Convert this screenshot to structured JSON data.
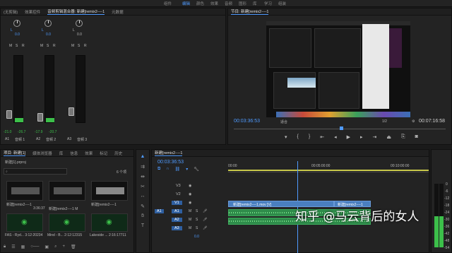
{
  "workspaces": [
    "组件",
    "编辑",
    "颜色",
    "效果",
    "音频",
    "图形",
    "库",
    "学习",
    "组装"
  ],
  "active_workspace": "编辑",
  "mixer": {
    "tabs": [
      "(无剪辑)",
      "效果控件",
      "音频剪辑混合器: 新建[remix2----1",
      "元数据"
    ],
    "channels": [
      {
        "label_l": "L",
        "val": "0.0",
        "ch": "A1",
        "name": "音频 1",
        "readout_l": "-21.0",
        "readout_r": "-26.7"
      },
      {
        "label_l": "L",
        "val": "0.0",
        "ch": "A2",
        "name": "音频 2",
        "readout_l": "-17.9",
        "readout_r": "-20.7"
      },
      {
        "label_l": "L",
        "val": "0.0",
        "ch": "A3",
        "name": "音频 3",
        "readout_l": "",
        "readout_r": ""
      }
    ],
    "msr": [
      "M",
      "S",
      "R"
    ]
  },
  "program": {
    "title": "节目: 新建[remix2----1",
    "timecode_left": "00:03:36:53",
    "fit": "适合",
    "page": "1/2",
    "timecode_right": "00:07:16:58"
  },
  "project": {
    "tabs": [
      "项目: 新建[1]",
      "媒体浏览器",
      "库",
      "信息",
      "效果",
      "标记",
      "历史"
    ],
    "file": "新建[1].prproj",
    "count": "6 个项",
    "search_placeholder": "",
    "items": [
      {
        "name": "新建[remix2----1",
        "dur": "3:36:37"
      },
      {
        "name": "新建[remix2----1 M",
        "dur": "7:16:58"
      },
      {
        "name": "新建[remix2----1",
        "dur": ""
      },
      {
        "name": "FAS - Ryd... 3:12:20234",
        "dur": ""
      },
      {
        "name": "Mind - B... 2:12:12315",
        "dur": ""
      },
      {
        "name": "Lakeside ... 2:16:17711",
        "dur": ""
      }
    ]
  },
  "timeline": {
    "tab": "新建[remix2----1",
    "timecode": "00:03:36:53",
    "ruler": [
      "00:00",
      "00:05:00:00",
      "00:10:00:00"
    ],
    "video_tracks": [
      "V3",
      "V2",
      "V1"
    ],
    "audio_tracks": [
      "A1",
      "A2",
      "A3"
    ],
    "source": "A1",
    "clip_v1_a": "新建[remix2----1.mov [V]",
    "clip_v1_b": "新建[remix2----1",
    "master_val": "0.0"
  },
  "meter_scale": [
    "0",
    "-6",
    "-12",
    "-18",
    "-24",
    "-30",
    "-36",
    "-42",
    "-48",
    "-54"
  ],
  "watermark": "知乎 @马云背后的女人"
}
